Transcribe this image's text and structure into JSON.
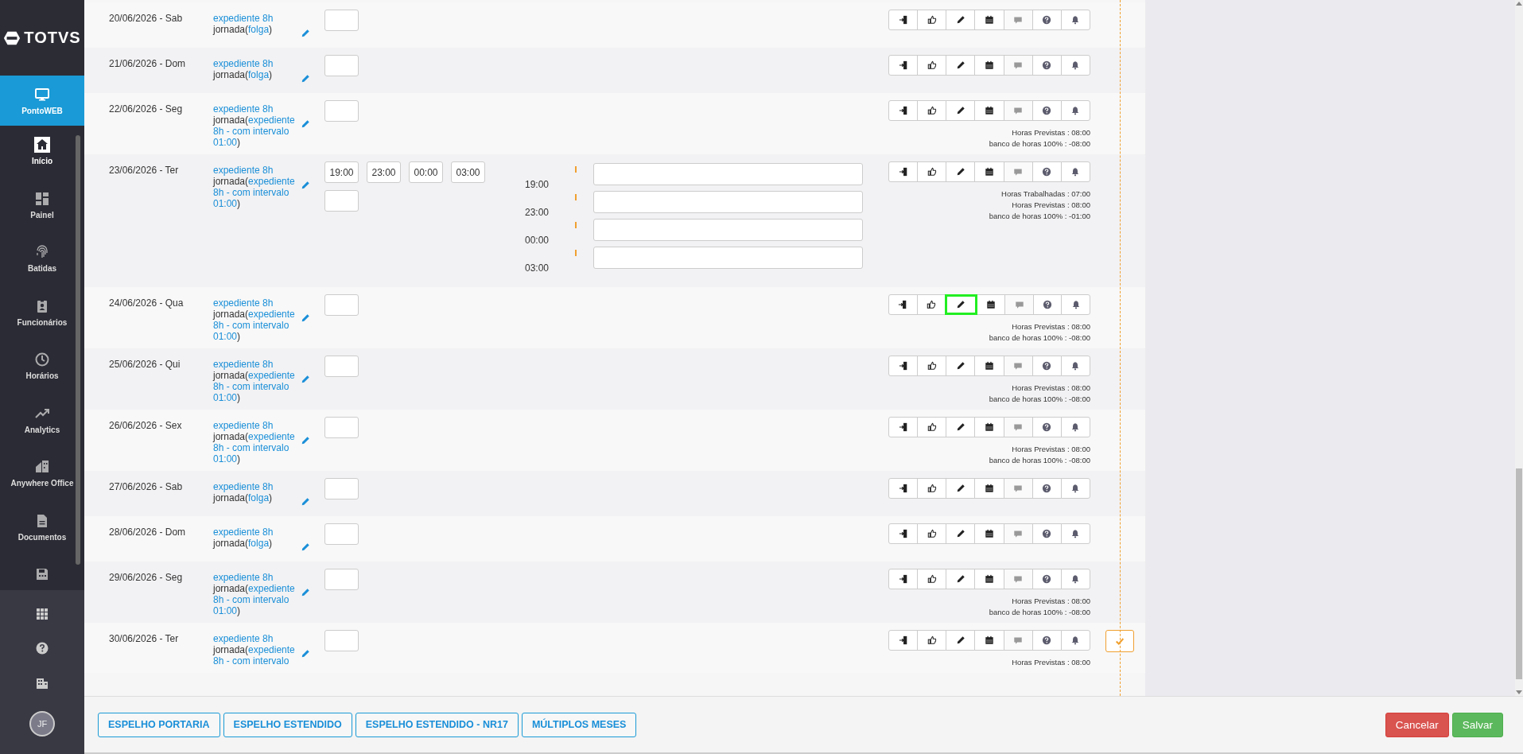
{
  "sidebar": {
    "logo": "TOTVS",
    "app": {
      "label": "PontoWEB",
      "selected": true
    },
    "items": [
      {
        "label": "Início",
        "selected": true
      },
      {
        "label": "Painel",
        "selected": false
      },
      {
        "label": "Batidas",
        "selected": false
      },
      {
        "label": "Funcionários",
        "selected": false
      },
      {
        "label": "Horários",
        "selected": false
      },
      {
        "label": "Analytics",
        "selected": false
      },
      {
        "label": "Anywhere Office",
        "selected": false
      },
      {
        "label": "Documentos",
        "selected": false
      },
      {
        "selected": false
      }
    ],
    "avatar": "JF"
  },
  "rows": [
    {
      "date": "20/06/2026 - Sab",
      "schedule": "expediente 8h",
      "jornada_prefix": "jornada(",
      "jornada": [
        "folga"
      ],
      "jornada_suffix": ")",
      "summary": [],
      "edit_focused": false,
      "confirm": false
    },
    {
      "date": "21/06/2026 - Dom",
      "schedule": "expediente 8h",
      "jornada_prefix": "jornada(",
      "jornada": [
        "folga"
      ],
      "jornada_suffix": ")",
      "summary": [],
      "edit_focused": false,
      "confirm": false
    },
    {
      "date": "22/06/2026 - Seg",
      "schedule": "expediente 8h",
      "jornada_prefix": "jornada(",
      "jornada": [
        "expediente",
        "8h - com intervalo",
        "01:00"
      ],
      "jornada_suffix": ")",
      "summary": [
        "Horas Previstas : 08:00",
        "banco de horas 100% : -08:00"
      ],
      "edit_focused": false,
      "confirm": false
    },
    {
      "date": "23/06/2026 - Ter",
      "schedule": "expediente 8h",
      "jornada_prefix": "jornada(",
      "jornada": [
        "expediente",
        "8h - com intervalo",
        "01:00"
      ],
      "jornada_suffix": ")",
      "punches": [
        "19:00",
        "23:00",
        "00:00",
        "03:00"
      ],
      "entries": [
        "19:00",
        "23:00",
        "00:00",
        "03:00"
      ],
      "summary": [
        "Horas Trabalhadas : 07:00",
        "Horas Previstas : 08:00",
        "banco de horas 100% : -01:00"
      ],
      "edit_focused": false,
      "confirm": false
    },
    {
      "date": "24/06/2026 - Qua",
      "schedule": "expediente 8h",
      "jornada_prefix": "jornada(",
      "jornada": [
        "expediente",
        "8h - com intervalo",
        "01:00"
      ],
      "jornada_suffix": ")",
      "summary": [
        "Horas Previstas : 08:00",
        "banco de horas 100% : -08:00"
      ],
      "edit_focused": true,
      "confirm": false
    },
    {
      "date": "25/06/2026 - Qui",
      "schedule": "expediente 8h",
      "jornada_prefix": "jornada(",
      "jornada": [
        "expediente",
        "8h - com intervalo",
        "01:00"
      ],
      "jornada_suffix": ")",
      "summary": [
        "Horas Previstas : 08:00",
        "banco de horas 100% : -08:00"
      ],
      "edit_focused": false,
      "confirm": false
    },
    {
      "date": "26/06/2026 - Sex",
      "schedule": "expediente 8h",
      "jornada_prefix": "jornada(",
      "jornada": [
        "expediente",
        "8h - com intervalo",
        "01:00"
      ],
      "jornada_suffix": ")",
      "summary": [
        "Horas Previstas : 08:00",
        "banco de horas 100% : -08:00"
      ],
      "edit_focused": false,
      "confirm": false
    },
    {
      "date": "27/06/2026 - Sab",
      "schedule": "expediente 8h",
      "jornada_prefix": "jornada(",
      "jornada": [
        "folga"
      ],
      "jornada_suffix": ")",
      "summary": [],
      "edit_focused": false,
      "confirm": false
    },
    {
      "date": "28/06/2026 - Dom",
      "schedule": "expediente 8h",
      "jornada_prefix": "jornada(",
      "jornada": [
        "folga"
      ],
      "jornada_suffix": ")",
      "summary": [],
      "edit_focused": false,
      "confirm": false
    },
    {
      "date": "29/06/2026 - Seg",
      "schedule": "expediente 8h",
      "jornada_prefix": "jornada(",
      "jornada": [
        "expediente",
        "8h - com intervalo",
        "01:00"
      ],
      "jornada_suffix": ")",
      "summary": [
        "Horas Previstas : 08:00",
        "banco de horas 100% : -08:00"
      ],
      "edit_focused": false,
      "confirm": false
    },
    {
      "date": "30/06/2026 - Ter",
      "schedule": "expediente 8h",
      "jornada_prefix": "jornada(",
      "jornada": [
        "expediente",
        "8h - com intervalo"
      ],
      "summary": [
        "Horas Previstas : 08:00"
      ],
      "edit_focused": false,
      "confirm": true
    }
  ],
  "footer": {
    "reports": [
      "ESPELHO PORTARIA",
      "ESPELHO ESTENDIDO",
      "ESPELHO ESTENDIDO - NR17",
      "MÚLTIPLOS MESES"
    ],
    "cancel": "Cancelar",
    "save": "Salvar"
  }
}
